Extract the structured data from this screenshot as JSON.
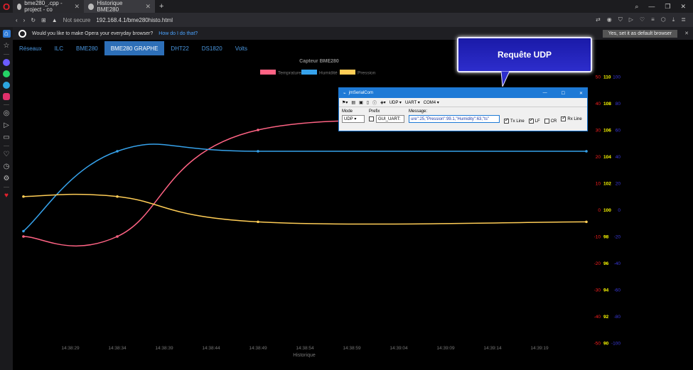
{
  "browser": {
    "tabs": [
      {
        "label": "bme280_.cpp - project - co",
        "active": false
      },
      {
        "label": "Historique BME280",
        "active": true
      }
    ],
    "url": "192.168.4.1/bme280histo.html",
    "not_secure": "Not secure",
    "infobar": {
      "text": "Would you like to make Opera your everyday browser?",
      "link": "How do I do that?",
      "button": "Yes, set it as default browser"
    }
  },
  "nav": {
    "items": [
      "Réseaux",
      "ILC",
      "BME280",
      "BME280 GRAPHE",
      "DHT22",
      "DS1820",
      "Volts"
    ],
    "active_index": 3
  },
  "callout": {
    "text": "Requête UDP"
  },
  "serial_window": {
    "title": "jmSerialCom",
    "toolbar": {
      "udp": "UDP",
      "uart": "UART",
      "com": "COM4"
    },
    "mode_label": "Mode",
    "mode_value": "UDP",
    "prefix_label": "Prefix",
    "prefix_value": "GUI_UART:",
    "message_label": "Message:",
    "message_value": "ure\":25,\"Pression\":99.1,\"Humidity\":63,\"ts\"",
    "tx_line": "Tx Line",
    "lf": "LF",
    "cr": "CR",
    "rx_line": "Rx Line"
  },
  "chart_data": {
    "type": "line",
    "title": "Capteur BME280",
    "xlabel": "Historique",
    "x": [
      "14:38:29",
      "14:38:34",
      "14:38:39",
      "14:38:44",
      "14:38:49",
      "14:38:54",
      "14:38:59",
      "14:39:04",
      "14:39:09",
      "14:39:14",
      "14:39:19"
    ],
    "point_times": [
      "14:38:24",
      "14:38:34",
      "14:38:49",
      "14:39:24"
    ],
    "series": [
      {
        "name": "Temprature",
        "color": "#ff6384",
        "axis": "temperature",
        "values": [
          -10,
          -10,
          30,
          30
        ]
      },
      {
        "name": "Humidité",
        "color": "#36a2eb",
        "axis": "humidity",
        "values": [
          -16,
          44,
          44,
          44
        ]
      },
      {
        "name": "Pression",
        "color": "#ffcd56",
        "axis": "pression",
        "values": [
          101,
          101,
          99.1,
          99.1
        ]
      }
    ],
    "axes": {
      "temperature": {
        "color": "#ff2020",
        "ticks": [
          "-50",
          "-40",
          "-30",
          "-20",
          "-10",
          "0",
          "10",
          "20",
          "30",
          "40",
          "50"
        ],
        "range": [
          -50,
          50
        ]
      },
      "pression": {
        "color": "#ffff00",
        "ticks": [
          "90",
          "92",
          "94",
          "96",
          "98",
          "100",
          "102",
          "104",
          "106",
          "108",
          "110"
        ],
        "range": [
          90,
          110
        ]
      },
      "humidity": {
        "color": "#3a3adf",
        "ticks": [
          "-100",
          "-80",
          "-60",
          "-40",
          "-20",
          "0",
          "20",
          "40",
          "60",
          "80",
          "100"
        ],
        "range": [
          -100,
          100
        ]
      }
    },
    "grid": false,
    "legend": "top-center"
  }
}
